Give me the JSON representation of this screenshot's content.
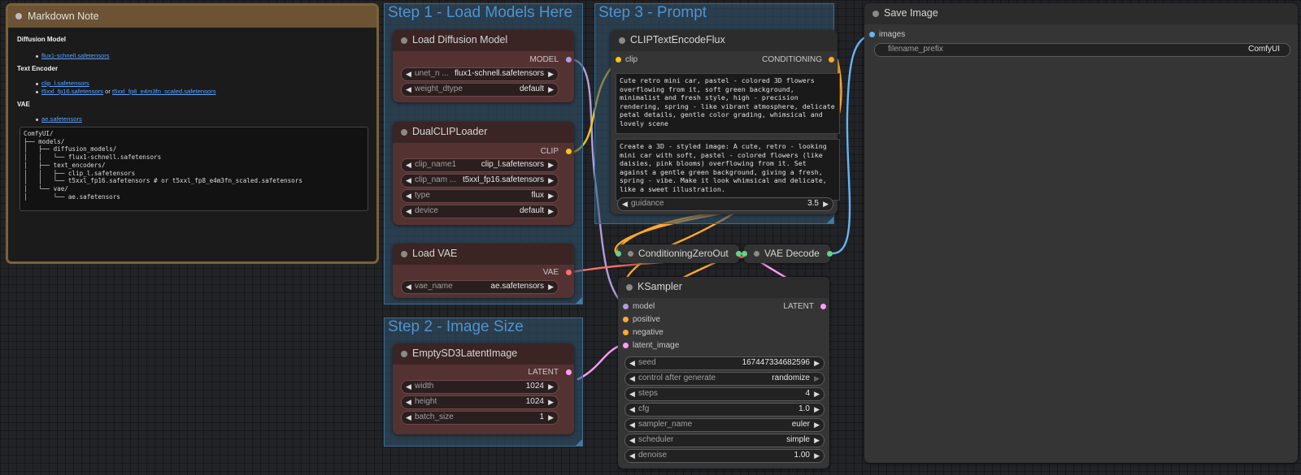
{
  "groups": {
    "step1": "Step 1 - Load Models Here",
    "step2": "Step 2 - Image Size",
    "step3": "Step 3 - Prompt"
  },
  "markdown_note": {
    "title": "Markdown Note",
    "heading_diffusion": "Diffusion Model",
    "link_flux": "flux1-schnell.safetensors",
    "heading_text_encoder": "Text Encoder",
    "link_clip": "clip_l.safetensors",
    "link_t5": "t5xxl_fp16.safetensors",
    "or_text": "or",
    "link_t5_fp8": "t5xxl_fp8_e4m3fn_scaled.safetensors",
    "heading_vae": "VAE",
    "link_vae": "ae.safetensors",
    "tree": "ComfyUI/\n├── models/\n│   ├── diffusion_models/\n│   │   └── flux1-schnell.safetensors\n│   ├── text_encoders/\n│   │   ├── clip_l.safetensors\n│   │   └── t5xxl_fp16.safetensors # or t5xxl_fp8_e4m3fn_scaled.safetensors\n│   └── vae/\n│       └── ae.safetensors"
  },
  "load_diffusion": {
    "title": "Load Diffusion Model",
    "output": "MODEL",
    "widgets": [
      {
        "name": "unet_n ...",
        "value": "flux1-schnell.safetensors"
      },
      {
        "name": "weight_dtype",
        "value": "default"
      }
    ]
  },
  "dual_clip": {
    "title": "DualCLIPLoader",
    "output": "CLIP",
    "widgets": [
      {
        "name": "clip_name1",
        "value": "clip_l.safetensors"
      },
      {
        "name": "clip_nam ...",
        "value": "t5xxl_fp16.safetensors"
      },
      {
        "name": "type",
        "value": "flux"
      },
      {
        "name": "device",
        "value": "default"
      }
    ]
  },
  "load_vae": {
    "title": "Load VAE",
    "output": "VAE",
    "widgets": [
      {
        "name": "vae_name",
        "value": "ae.safetensors"
      }
    ]
  },
  "empty_latent": {
    "title": "EmptySD3LatentImage",
    "output": "LATENT",
    "widgets": [
      {
        "name": "width",
        "value": "1024"
      },
      {
        "name": "height",
        "value": "1024"
      },
      {
        "name": "batch_size",
        "value": "1"
      }
    ]
  },
  "clip_text_encode": {
    "title": "CLIPTextEncodeFlux",
    "input": "clip",
    "output": "CONDITIONING",
    "clip_l_text": "Cute retro mini car, pastel - colored 3D flowers overflowing from it, soft green background, minimalist and fresh style, high - precision rendering, spring - like vibrant atmosphere, delicate petal details, gentle color grading, whimsical and lovely scene",
    "t5xxl_text": "Create a 3D - styled image: A cute, retro - looking mini car with soft, pastel - colored flowers (like daisies, pink blooms) overflowing from it. Set against a gentle green background, giving a fresh, spring - vibe. Make it look whimsical and delicate, like a sweet illustration.",
    "widgets": [
      {
        "name": "guidance",
        "value": "3.5"
      }
    ]
  },
  "conditioning_zero_out": {
    "title": "ConditioningZeroOut"
  },
  "vae_decode": {
    "title": "VAE Decode"
  },
  "ksampler": {
    "title": "KSampler",
    "inputs": [
      "model",
      "positive",
      "negative",
      "latent_image"
    ],
    "output": "LATENT",
    "widgets": [
      {
        "name": "seed",
        "value": "167447334682596"
      },
      {
        "name": "control after generate",
        "value": "randomize"
      },
      {
        "name": "steps",
        "value": "4"
      },
      {
        "name": "cfg",
        "value": "1.0"
      },
      {
        "name": "sampler_name",
        "value": "euler"
      },
      {
        "name": "scheduler",
        "value": "simple"
      },
      {
        "name": "denoise",
        "value": "1.00"
      }
    ]
  },
  "save_image": {
    "title": "Save Image",
    "input": "images",
    "widgets": [
      {
        "name": "filename_prefix",
        "value": "ComfyUI"
      }
    ]
  },
  "colors": {
    "model": "#b39ddb",
    "clip": "#f5c518",
    "vae": "#ff6e6e",
    "latent": "#ff9cf9",
    "conditioning": "#ffa931",
    "image": "#64b5f6"
  }
}
